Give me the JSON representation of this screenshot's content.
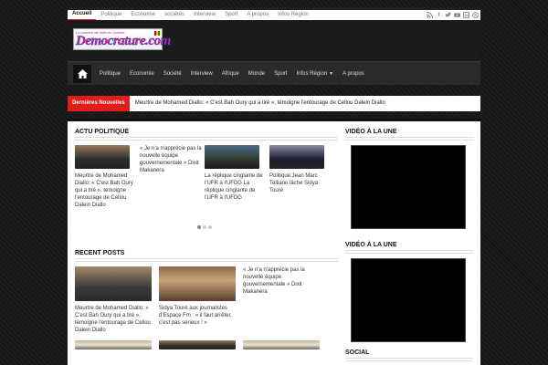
{
  "topnav": [
    "Accueil",
    "Politique",
    "Economie",
    "sociétés",
    "Interview",
    "Sport",
    "A propos",
    "Infos Région"
  ],
  "mainnav": [
    "Politique",
    "Economie",
    "Société",
    "Interview",
    "Afrique",
    "Monde",
    "Sport",
    "Infos Région",
    "A propos"
  ],
  "logo": {
    "tagline": "Le numéro de l'info en Guinée",
    "name": "Democrature.com"
  },
  "breaking": {
    "label": "Dernières Nouvelles",
    "text": "Meurtre de Mohamed Diallo: « C'est Bah Oury qui a tiré », témoigne l'entourage de Cellou Dalein Diallo"
  },
  "politics": {
    "title": "ACTU POLITIQUE",
    "items": [
      "Meurtre de Mohamed Diallo: « C'est Bah Oury qui a tiré », témoigne l'entourage de Cellou Dalein Diallo",
      "« Je n'a n'apprécie pas la nouvelle équipe gouvernementale » Dixit Makanera",
      "La réplique cinglante de l'UFR à l'UFDG La réplique cinglante de l'UFR à l'UFDG",
      "Politique:Jean Marc Telliano lâche Sidya Touré"
    ]
  },
  "recent": {
    "title": "RECENT POSTS",
    "items": [
      "Meurtre de Mohamed Diallo: « C'est Bah Oury qui a tiré », témoigne l'entourage de Cellou Dalein Diallo",
      "Sidya Touré aux journalistes d'Espace Fm : « il faut arrêter, c'est pas sérieux ! »",
      "« Je n'a n'apprécie pas la nouvelle équipe gouvernementale » Dixit Makanera"
    ]
  },
  "sidebar": {
    "video1": "VIDÉO À LA UNE",
    "video2": "VIDÉO À LA UNE",
    "social": "SOCIAL"
  },
  "colors": {
    "accent": "#e21b1b",
    "header_bg": "#1b1b1b",
    "nav_bg": "#2a2a2a"
  }
}
